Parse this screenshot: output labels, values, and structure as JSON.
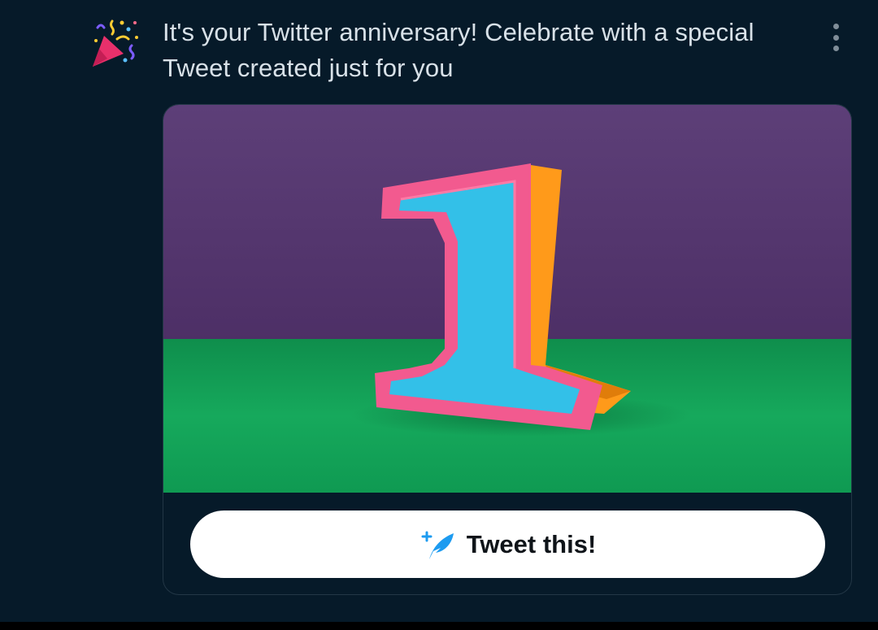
{
  "notification": {
    "icon": "party-popper-icon",
    "message": "It's your Twitter anniversary! Celebrate with a special Tweet created just for you",
    "more_icon": "more-vertical-icon"
  },
  "card": {
    "image": {
      "description_icon": "anniversary-number-one-image",
      "colors": {
        "wall": "#5a3a73",
        "floor": "#139a54",
        "number_outline": "#f25a8f",
        "number_face": "#33c0e8",
        "number_side": "#ff9a1a"
      }
    },
    "tweet_button": {
      "icon": "quill-plus-icon",
      "label": "Tweet this!"
    }
  },
  "colors": {
    "background": "#061a29",
    "text": "#d8e1e8",
    "button_bg": "#ffffff",
    "accent": "#1d9bf0"
  }
}
